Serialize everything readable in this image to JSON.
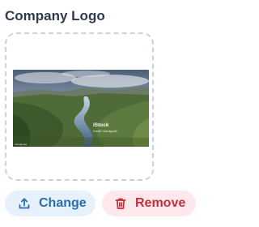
{
  "logo_section": {
    "title": "Company Logo",
    "image": {
      "watermark_brand": "iStock",
      "watermark_credit": "Credit: ricardgould",
      "corner_credit": "ricardgould"
    },
    "change_button": {
      "label": "Change",
      "icon": "upload-icon"
    },
    "remove_button": {
      "label": "Remove",
      "icon": "trash-icon"
    }
  },
  "colors": {
    "title": "#2f3a4d",
    "dropzone_border": "#c9d2dc",
    "change_bg": "#e6f1fc",
    "change_text": "#2b6cb0",
    "remove_bg": "#fde8eb",
    "remove_text": "#c5303f"
  }
}
